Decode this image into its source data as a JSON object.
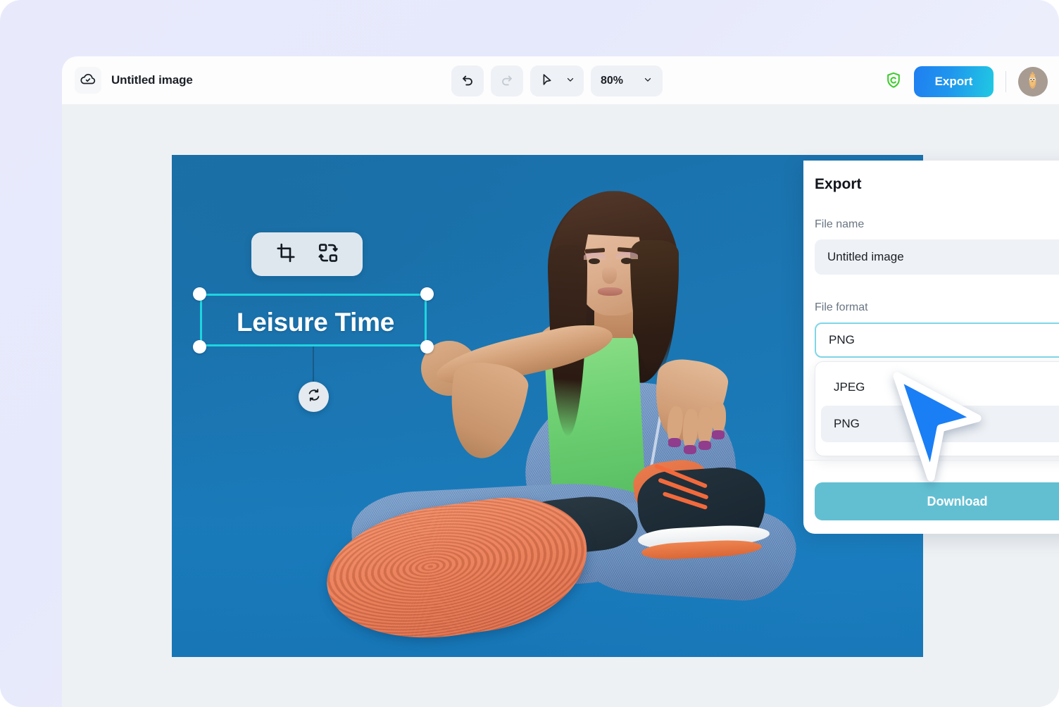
{
  "app": {
    "document_title": "Untitled image",
    "cloud_icon": "cloud-check-icon"
  },
  "toolbar": {
    "undo": {
      "icon": "undo-icon",
      "label": "Undo",
      "enabled": true
    },
    "redo": {
      "icon": "redo-icon",
      "label": "Redo",
      "enabled": false
    },
    "select_tool": {
      "icon": "cursor-arrow-icon",
      "label": "Select tool",
      "chevron": "chevron-down-icon"
    },
    "zoom": {
      "value": "80%",
      "chevron": "chevron-down-icon"
    },
    "shield": {
      "icon": "shield-c-icon",
      "color": "#3fcb2e"
    },
    "export_label": "Export",
    "avatar": "user-avatar"
  },
  "canvas": {
    "text_element": {
      "content": "Leisure Time",
      "selected": true
    },
    "mini_toolbar": {
      "crop": "crop-icon",
      "replace": "replace-swap-icon"
    },
    "rotate_handle": "rotate-icon",
    "photo_alt": "Woman in green crop top and blue jeans sitting against blue backdrop"
  },
  "export_panel": {
    "title": "Export",
    "file_name_label": "File name",
    "file_name_value": "Untitled image",
    "file_name_placeholder": "Untitled image",
    "file_format_label": "File format",
    "file_format_value": "PNG",
    "format_chevron": "chevron-up-icon",
    "options": [
      {
        "label": "JPEG",
        "selected": false
      },
      {
        "label": "PNG",
        "selected": true
      }
    ],
    "check_icon": "check-icon",
    "download_label": "Download"
  },
  "colors": {
    "accent_cyan": "#1fd4e0",
    "export_gradient_start": "#1f7ff0",
    "export_gradient_end": "#20c9e2",
    "download_button": "#62bfd2",
    "shield_green": "#3fcb2e",
    "cursor_blue": "#1a7ef5",
    "select_border": "#7fd6e8"
  }
}
